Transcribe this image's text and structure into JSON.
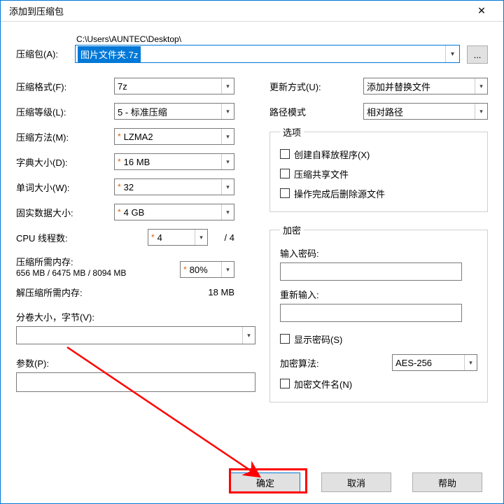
{
  "window": {
    "title": "添加到压缩包",
    "close_glyph": "✕"
  },
  "archive": {
    "label": "压缩包(A):",
    "path": "C:\\Users\\AUNTEC\\Desktop\\",
    "filename": "图片文件夹.7z",
    "browse_label": "..."
  },
  "left": {
    "format_label": "压缩格式(F):",
    "format_value": "7z",
    "level_label": "压缩等级(L):",
    "level_value": "5 - 标准压缩",
    "method_label": "压缩方法(M):",
    "method_value": "LZMA2",
    "dict_label": "字典大小(D):",
    "dict_value": "16 MB",
    "word_label": "单词大小(W):",
    "word_value": "32",
    "solid_label": "固实数据大小:",
    "solid_value": "4 GB",
    "threads_label": "CPU 线程数:",
    "threads_value": "4",
    "threads_max": "/ 4",
    "compress_mem_label": "压缩所需内存:",
    "compress_mem_detail": "656 MB / 6475 MB / 8094 MB",
    "compress_mem_value": "80%",
    "decompress_mem_label": "解压缩所需内存:",
    "decompress_mem_value": "18 MB",
    "split_label": "分卷大小，字节(V):",
    "params_label": "参数(P):"
  },
  "right": {
    "update_label": "更新方式(U):",
    "update_value": "添加并替换文件",
    "pathmode_label": "路径模式",
    "pathmode_value": "相对路径",
    "options_legend": "选项",
    "opt_sfx": "创建自释放程序(X)",
    "opt_shared": "压缩共享文件",
    "opt_delete": "操作完成后删除源文件",
    "enc_legend": "加密",
    "pw_label": "输入密码:",
    "pw2_label": "重新输入:",
    "show_pw": "显示密码(S)",
    "enc_method_label": "加密算法:",
    "enc_method_value": "AES-256",
    "enc_names": "加密文件名(N)"
  },
  "buttons": {
    "ok": "确定",
    "cancel": "取消",
    "help": "帮助"
  }
}
